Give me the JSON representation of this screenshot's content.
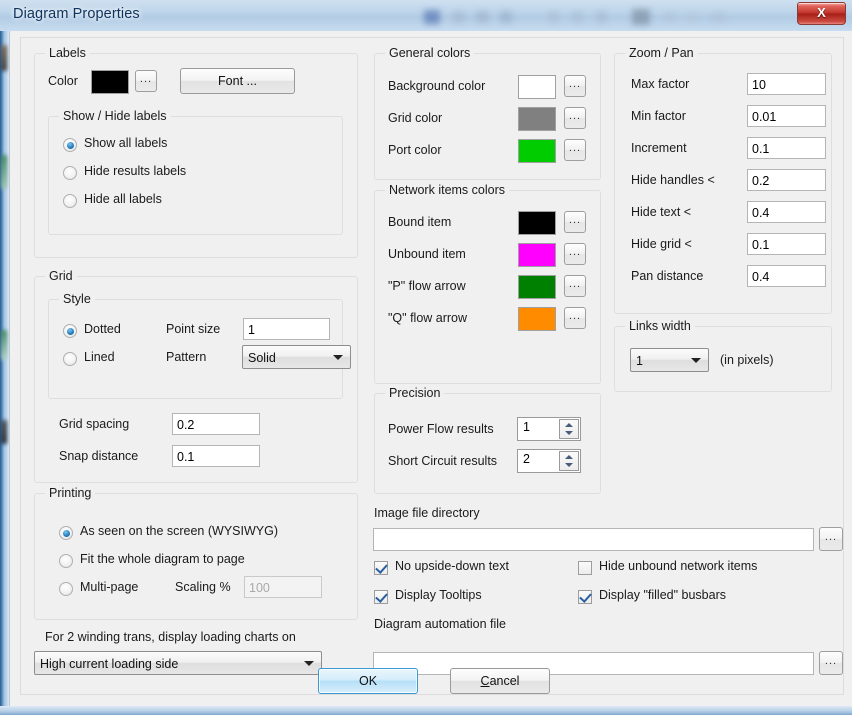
{
  "window": {
    "title": "Diagram Properties",
    "close_label": "X",
    "close_icon": "close-icon"
  },
  "labels_group": {
    "caption": "Labels",
    "color_label": "Color",
    "color_value": "#000000",
    "color_browse": "...",
    "font_button": "Font ...",
    "showhide": {
      "caption": "Show / Hide labels",
      "options": [
        {
          "label": "Show all labels",
          "selected": true
        },
        {
          "label": "Hide results labels",
          "selected": false
        },
        {
          "label": "Hide all labels",
          "selected": false
        }
      ]
    }
  },
  "grid_group": {
    "caption": "Grid",
    "style": {
      "caption": "Style",
      "options": [
        {
          "label": "Dotted",
          "selected": true
        },
        {
          "label": "Lined",
          "selected": false
        }
      ],
      "point_size_label": "Point size",
      "point_size_value": "1",
      "pattern_label": "Pattern",
      "pattern_value": "Solid"
    },
    "grid_spacing_label": "Grid spacing",
    "grid_spacing_value": "0.2",
    "snap_distance_label": "Snap distance",
    "snap_distance_value": "0.1"
  },
  "printing_group": {
    "caption": "Printing",
    "options": [
      {
        "label": "As seen on the screen (WYSIWYG)",
        "selected": true
      },
      {
        "label": "Fit the whole diagram to page",
        "selected": false
      },
      {
        "label": "Multi-page",
        "selected": false
      }
    ],
    "scaling_label": "Scaling %",
    "scaling_value": "100"
  },
  "loading_charts": {
    "label": "For 2 winding trans, display loading charts on",
    "value": "High current loading side"
  },
  "general_colors": {
    "caption": "General colors",
    "rows": [
      {
        "label": "Background color",
        "color": "#ffffff",
        "browse": "..."
      },
      {
        "label": "Grid color",
        "color": "#808080",
        "browse": "..."
      },
      {
        "label": "Port color",
        "color": "#00cc00",
        "browse": "..."
      }
    ]
  },
  "network_items_colors": {
    "caption": "Network items colors",
    "rows": [
      {
        "label": "Bound item",
        "color": "#000000",
        "browse": "..."
      },
      {
        "label": "Unbound item",
        "color": "#ff00ff",
        "browse": "..."
      },
      {
        "label": "\"P\" flow arrow",
        "color": "#008000",
        "browse": "..."
      },
      {
        "label": "\"Q\" flow arrow",
        "color": "#ff8c00",
        "browse": "..."
      }
    ]
  },
  "precision_group": {
    "caption": "Precision",
    "rows": [
      {
        "label": "Power Flow results",
        "value": "1"
      },
      {
        "label": "Short Circuit results",
        "value": "2"
      }
    ]
  },
  "zoom_pan_group": {
    "caption": "Zoom / Pan",
    "rows": [
      {
        "label": "Max factor",
        "value": "10"
      },
      {
        "label": "Min factor",
        "value": "0.01"
      },
      {
        "label": "Increment",
        "value": "0.1"
      },
      {
        "label": "Hide handles <",
        "value": "0.2"
      },
      {
        "label": "Hide text <",
        "value": "0.4"
      },
      {
        "label": "Hide grid <",
        "value": "0.1"
      },
      {
        "label": "Pan distance",
        "value": "0.4"
      }
    ]
  },
  "links_width_group": {
    "caption": "Links width",
    "value": "1",
    "suffix": "(in pixels)"
  },
  "image_file_directory": {
    "label": "Image file directory",
    "value": "",
    "browse": "..."
  },
  "diagram_automation_file": {
    "label": "Diagram automation file",
    "value": "",
    "browse": "..."
  },
  "checkboxes": [
    {
      "label": "No upside-down text",
      "checked": true
    },
    {
      "label": "Hide unbound network items",
      "checked": false
    },
    {
      "label": "Display Tooltips",
      "checked": true
    },
    {
      "label": "Display \"filled\" busbars",
      "checked": true
    }
  ],
  "footer": {
    "ok_label": "OK",
    "cancel_label": "Cancel"
  }
}
